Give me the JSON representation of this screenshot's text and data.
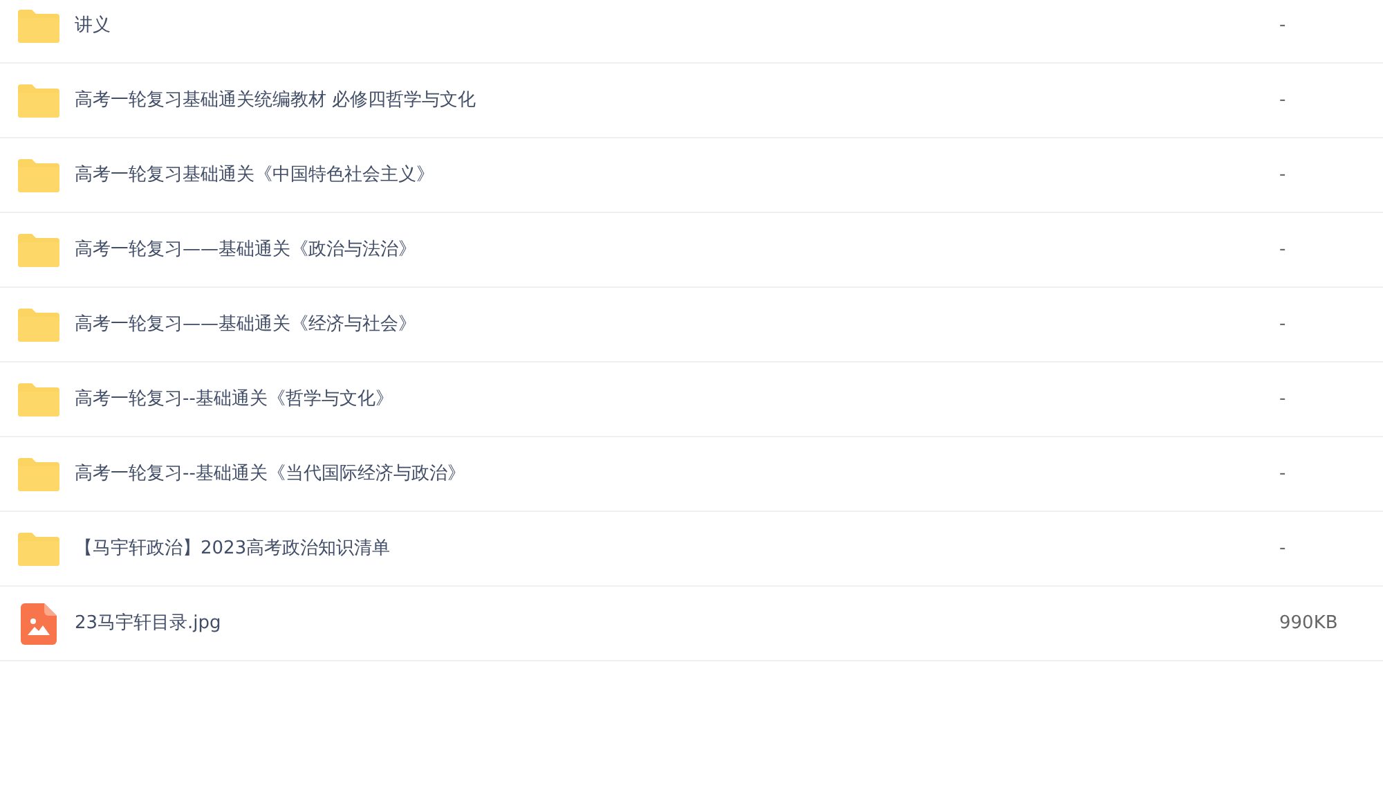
{
  "files": [
    {
      "kind": "folder",
      "name": "讲义",
      "size": "-"
    },
    {
      "kind": "folder",
      "name": "高考一轮复习基础通关统编教材 必修四哲学与文化",
      "size": "-"
    },
    {
      "kind": "folder",
      "name": "高考一轮复习基础通关《中国特色社会主义》",
      "size": "-"
    },
    {
      "kind": "folder",
      "name": "高考一轮复习——基础通关《政治与法治》",
      "size": "-"
    },
    {
      "kind": "folder",
      "name": "高考一轮复习——基础通关《经济与社会》",
      "size": "-"
    },
    {
      "kind": "folder",
      "name": "高考一轮复习--基础通关《哲学与文化》",
      "size": "-"
    },
    {
      "kind": "folder",
      "name": "高考一轮复习--基础通关《当代国际经济与政治》",
      "size": "-"
    },
    {
      "kind": "folder",
      "name": "【马宇轩政治】2023高考政治知识清单",
      "size": "-"
    },
    {
      "kind": "image",
      "name": "23马宇轩目录.jpg",
      "size": "990KB"
    }
  ]
}
